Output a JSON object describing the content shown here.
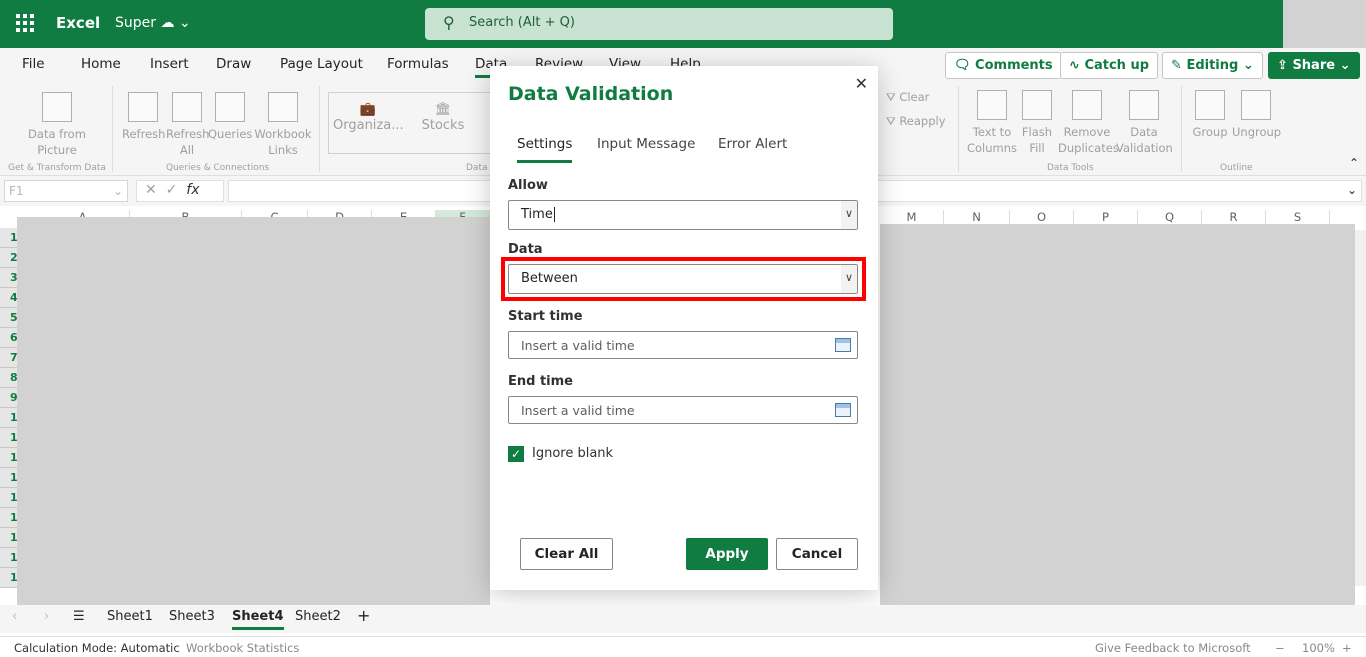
{
  "app": {
    "name": "Excel",
    "document": "Super",
    "search_placeholder": "Search (Alt + Q)"
  },
  "ribbon_tabs": [
    "File",
    "Home",
    "Insert",
    "Draw",
    "Page Layout",
    "Formulas",
    "Data",
    "Review",
    "View",
    "Help"
  ],
  "active_ribbon_tab": "Data",
  "top_buttons": {
    "comments": "Comments",
    "catchup": "Catch up",
    "editing": "Editing",
    "share": "Share"
  },
  "ribbon": {
    "get_transform": {
      "data_from_picture": "Data from Picture",
      "group": "Get & Transform Data"
    },
    "queries": {
      "refresh": "Refresh",
      "refresh_all": "Refresh All",
      "queries": "Queries",
      "workbook_links": "Workbook Links",
      "group": "Queries & Connections"
    },
    "data_types": {
      "organization": "Organiza...",
      "stocks": "Stocks",
      "group": "Data"
    },
    "sort_filter": {
      "clear": "Clear",
      "reapply": "Reapply"
    },
    "data_tools": {
      "text_to_columns": "Text to Columns",
      "flash_fill": "Flash Fill",
      "remove_duplicates": "Remove Duplicates",
      "data_validation": "Data Validation",
      "group": "Data Tools"
    },
    "outline": {
      "group_btn": "Group",
      "ungroup": "Ungroup",
      "group": "Outline"
    }
  },
  "formula_bar": {
    "name_box": "F1",
    "fx": "fx"
  },
  "columns": [
    "A",
    "B",
    "C",
    "D",
    "E",
    "F",
    "M",
    "N",
    "O",
    "P",
    "Q",
    "R",
    "S"
  ],
  "rows": [
    "1",
    "2",
    "3",
    "4",
    "5",
    "6",
    "7",
    "8",
    "9",
    "1",
    "1",
    "1",
    "1",
    "1",
    "1",
    "1",
    "1",
    "1"
  ],
  "dialog": {
    "title": "Data Validation",
    "tabs": [
      "Settings",
      "Input Message",
      "Error Alert"
    ],
    "allow_label": "Allow",
    "allow_value": "Time",
    "data_label": "Data",
    "data_value": "Between",
    "start_label": "Start time",
    "start_placeholder": "Insert a valid time",
    "end_label": "End time",
    "end_placeholder": "Insert a valid time",
    "ignore_blank": "Ignore blank",
    "ignore_blank_checked": true,
    "clear_all": "Clear All",
    "apply": "Apply",
    "cancel": "Cancel"
  },
  "sheets": [
    "Sheet1",
    "Sheet3",
    "Sheet4",
    "Sheet2"
  ],
  "active_sheet": "Sheet4",
  "status": {
    "calc_mode": "Calculation Mode: Automatic",
    "stats": "Workbook Statistics",
    "feedback": "Give Feedback to Microsoft",
    "zoom": "100%"
  },
  "colors": {
    "brand": "#107c41",
    "highlight": "#ff0000"
  }
}
